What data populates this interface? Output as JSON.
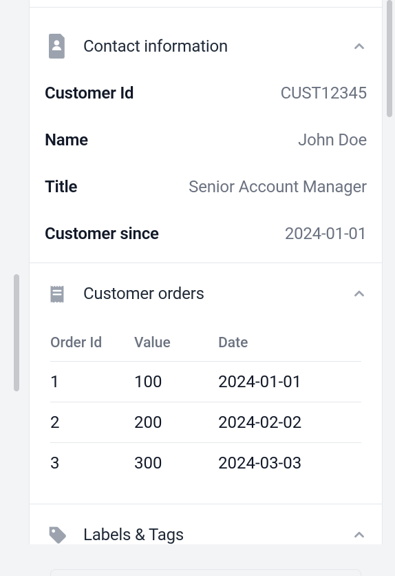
{
  "sections": {
    "contact": {
      "title": "Contact information",
      "rows": {
        "customer_id": {
          "label": "Customer Id",
          "value": "CUST12345"
        },
        "name": {
          "label": "Name",
          "value": "John Doe"
        },
        "title": {
          "label": "Title",
          "value": "Senior Account Manager"
        },
        "since": {
          "label": "Customer since",
          "value": "2024-01-01"
        }
      }
    },
    "orders": {
      "title": "Customer orders",
      "columns": {
        "order_id": "Order Id",
        "value": "Value",
        "date": "Date"
      },
      "items": [
        {
          "order_id": "1",
          "value": "100",
          "date": "2024-01-01"
        },
        {
          "order_id": "2",
          "value": "200",
          "date": "2024-02-02"
        },
        {
          "order_id": "3",
          "value": "300",
          "date": "2024-03-03"
        }
      ]
    },
    "labels": {
      "title": "Labels & Tags"
    }
  }
}
